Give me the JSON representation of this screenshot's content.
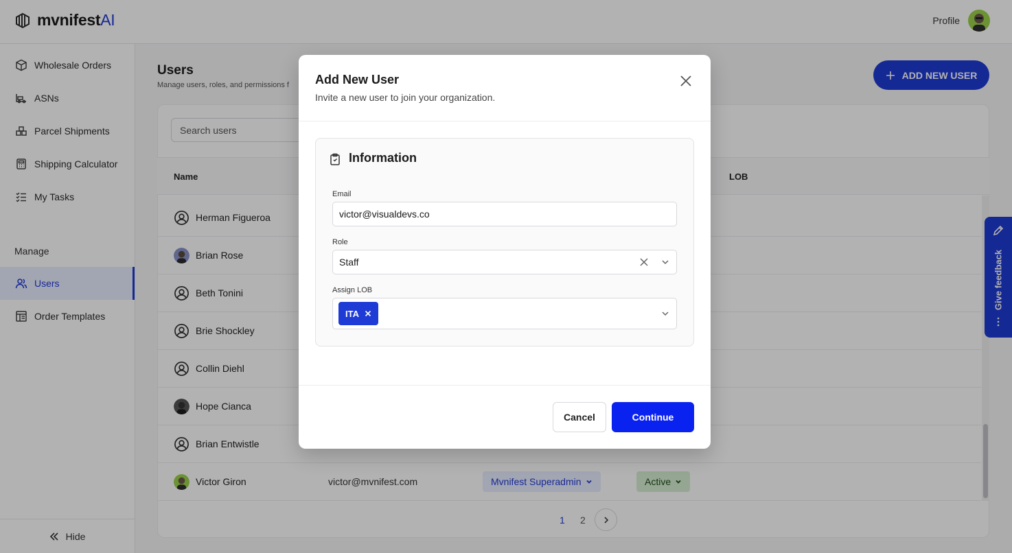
{
  "app": {
    "logo_text": "mvnifest",
    "logo_ai": "AI",
    "profile_label": "Profile"
  },
  "sidebar": {
    "items": [
      {
        "label": "Wholesale Orders",
        "icon": "box-icon"
      },
      {
        "label": "ASNs",
        "icon": "truck-icon"
      },
      {
        "label": "Parcel Shipments",
        "icon": "parcel-icon"
      },
      {
        "label": "Shipping Calculator",
        "icon": "calculator-icon"
      },
      {
        "label": "My Tasks",
        "icon": "task-list-icon"
      }
    ],
    "section_label": "Manage",
    "manage_items": [
      {
        "label": "Users",
        "icon": "users-icon",
        "active": true
      },
      {
        "label": "Order Templates",
        "icon": "template-icon"
      }
    ],
    "hide_label": "Hide"
  },
  "page": {
    "title": "Users",
    "subtitle": "Manage users, roles, and permissions f",
    "add_button": "ADD NEW USER",
    "search_placeholder": "Search users"
  },
  "table": {
    "headers": {
      "name": "Name",
      "lob": "LOB"
    },
    "rows": [
      {
        "name": "Herman Figueroa",
        "email": "",
        "role": "",
        "status": "",
        "avatar": "default-avatar-icon"
      },
      {
        "name": "Brian Rose",
        "email": "",
        "role": "",
        "status": "",
        "avatar": "photo-avatar"
      },
      {
        "name": "Beth Tonini",
        "email": "",
        "role": "",
        "status": "",
        "avatar": "default-avatar-icon"
      },
      {
        "name": "Brie Shockley",
        "email": "",
        "role": "",
        "status": "",
        "avatar": "default-avatar-icon"
      },
      {
        "name": "Collin Diehl",
        "email": "",
        "role": "",
        "status": "",
        "avatar": "default-avatar-icon"
      },
      {
        "name": "Hope Cianca",
        "email": "",
        "role": "",
        "status": "",
        "avatar": "photo-avatar"
      },
      {
        "name": "Brian Entwistle",
        "email": "",
        "role": "",
        "status": "",
        "avatar": "default-avatar-icon"
      },
      {
        "name": "Victor Giron",
        "email": "victor@mvnifest.com",
        "role": "Mvnifest Superadmin",
        "status": "Active",
        "avatar": "photo-avatar"
      }
    ]
  },
  "pagination": {
    "pages": [
      "1",
      "2"
    ],
    "current": "1"
  },
  "feedback": {
    "label": "Give feedback"
  },
  "modal": {
    "title": "Add New User",
    "subtitle": "Invite a new user to join your organization.",
    "section_title": "Information",
    "email_label": "Email",
    "email_value": "victor@visualdevs.co",
    "role_label": "Role",
    "role_value": "Staff",
    "lob_label": "Assign LOB",
    "lob_chips": [
      "ITA"
    ],
    "cancel_label": "Cancel",
    "continue_label": "Continue"
  },
  "colors": {
    "accent": "#1f3bd6",
    "continue": "#0a22f0",
    "status_active_bg": "#d6efd2",
    "role_bg": "#e9ecff"
  }
}
